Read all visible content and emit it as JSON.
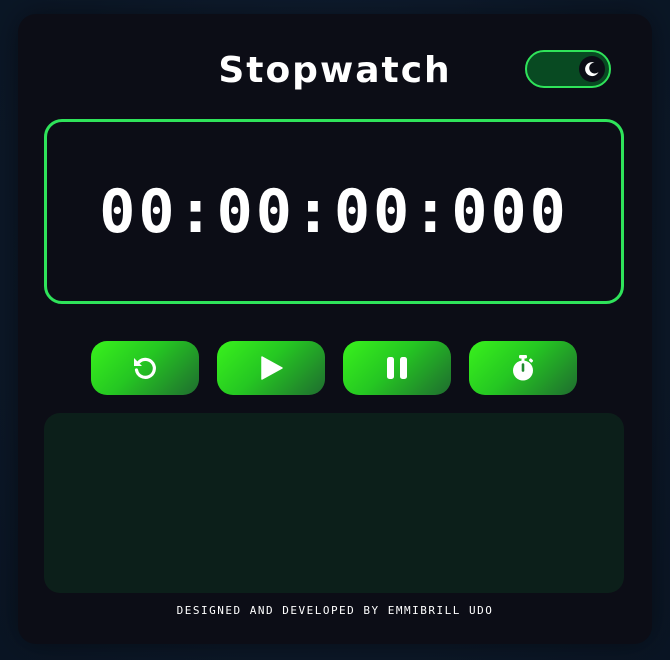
{
  "app": {
    "title": "Stopwatch"
  },
  "theme_toggle": {
    "icon": "moon-icon",
    "state": "dark"
  },
  "timer": {
    "display": "00:00:00:000"
  },
  "controls": [
    {
      "name": "reset",
      "icon": "reset-icon"
    },
    {
      "name": "start",
      "icon": "play-icon"
    },
    {
      "name": "pause",
      "icon": "pause-icon"
    },
    {
      "name": "lap",
      "icon": "stopwatch-icon"
    }
  ],
  "laps": {
    "items": []
  },
  "footer": {
    "credit": "DESIGNED AND DEVELOPED BY EMMIBRILL UDO"
  },
  "colors": {
    "accent": "#2fe35a",
    "card_bg": "#0c0d16",
    "laps_bg": "#0c1f1a",
    "toggle_bg": "#084a22"
  }
}
